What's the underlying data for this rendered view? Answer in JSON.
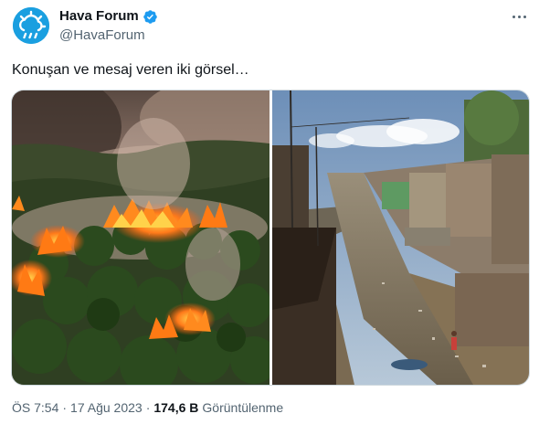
{
  "author": {
    "display_name": "Hava Forum",
    "handle": "@HavaForum",
    "avatar_icon": "weather-cloud-sun-icon",
    "verified_icon": "verified-badge-icon",
    "brand_color": "#1a9fe0",
    "verified_color": "#1d9bf0"
  },
  "tweet": {
    "text": "Konuşan ve mesaj veren iki görsel…",
    "more_icon": "more-horizontal-icon"
  },
  "media": [
    {
      "description_icon": "forest-fire-photo"
    },
    {
      "description_icon": "flooded-slum-photo"
    }
  ],
  "meta": {
    "time": "ÖS 7:54",
    "separator": "·",
    "date": "17 Ağu 2023",
    "views_count": "174,6 B",
    "views_label": "Görüntülenme"
  }
}
